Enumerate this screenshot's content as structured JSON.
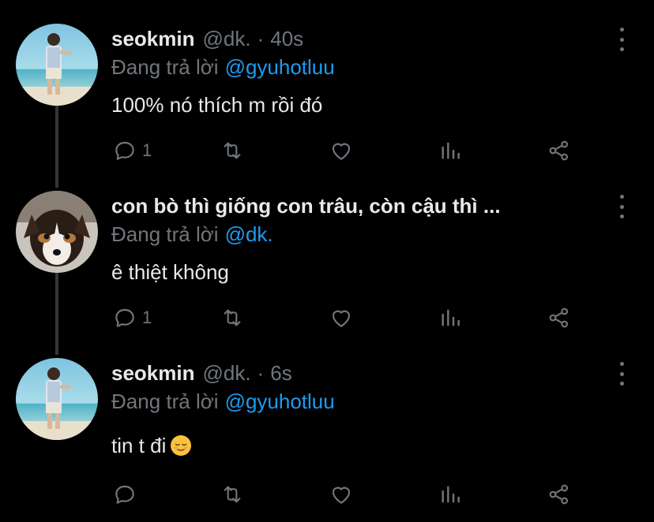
{
  "tweets": [
    {
      "name": "seokmin",
      "handle": "@dk.",
      "separator": "·",
      "time": "40s",
      "reply_prefix": "Đang trả lời",
      "reply_to": "@gyuhotluu",
      "text": "100% nó thích m rồi đó",
      "reply_count": "1"
    },
    {
      "name": "con bò thì giống con trâu, còn cậu thì ...",
      "reply_prefix": "Đang trả lời",
      "reply_to": "@dk.",
      "text": "ê thiệt không",
      "reply_count": "1"
    },
    {
      "name": "seokmin",
      "handle": "@dk.",
      "separator": "·",
      "time": "6s",
      "reply_prefix": "Đang trả lời",
      "reply_to": "@gyuhotluu",
      "text": "tin t đi",
      "emoji": "relieved-face-emoji"
    }
  ],
  "colors": {
    "background": "#000000",
    "text": "#e7e9ea",
    "muted": "#71767b",
    "mention": "#1d9bf0",
    "thread_line": "#333639"
  },
  "icons": [
    "reply-icon",
    "retweet-icon",
    "like-icon",
    "analytics-icon",
    "share-icon",
    "more-icon"
  ]
}
